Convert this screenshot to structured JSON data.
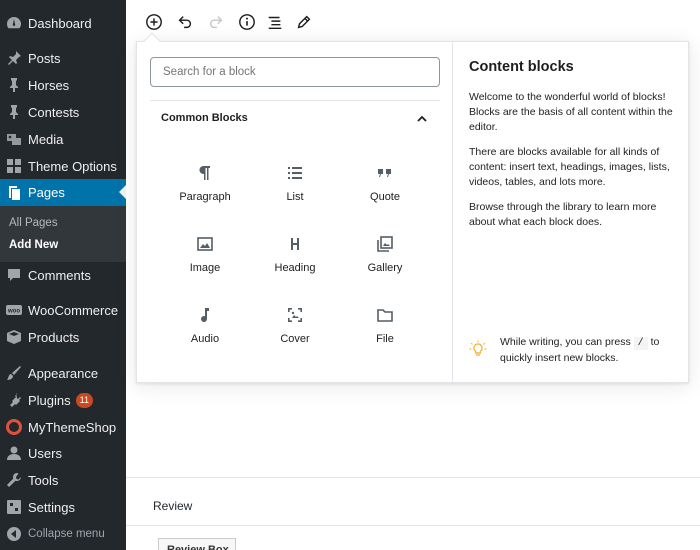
{
  "sidebar": {
    "items": [
      {
        "label": "Dashboard",
        "icon": "dashboard-icon"
      },
      {
        "label": "Posts",
        "icon": "pin-icon"
      },
      {
        "label": "Horses",
        "icon": "pin-icon"
      },
      {
        "label": "Contests",
        "icon": "pin-icon"
      },
      {
        "label": "Media",
        "icon": "media-icon"
      },
      {
        "label": "Theme Options",
        "icon": "grid-icon"
      },
      {
        "label": "Pages",
        "icon": "pages-icon",
        "active": true
      },
      {
        "label": "Comments",
        "icon": "comment-icon"
      },
      {
        "label": "WooCommerce",
        "icon": "woo-icon"
      },
      {
        "label": "Products",
        "icon": "box-icon"
      },
      {
        "label": "Appearance",
        "icon": "brush-icon"
      },
      {
        "label": "Plugins",
        "icon": "plug-icon",
        "badge": "11"
      },
      {
        "label": "MyThemeShop",
        "icon": "lifebuoy-icon"
      },
      {
        "label": "Users",
        "icon": "user-icon"
      },
      {
        "label": "Tools",
        "icon": "wrench-icon"
      },
      {
        "label": "Settings",
        "icon": "settings-icon"
      }
    ],
    "submenu": {
      "all_pages": "All Pages",
      "add_new": "Add New"
    },
    "collapse_label": "Collapse menu"
  },
  "toolbar": {
    "buttons": [
      "add-block-icon",
      "undo-icon",
      "redo-icon",
      "info-icon",
      "outline-icon",
      "edit-icon"
    ]
  },
  "inserter": {
    "search_placeholder": "Search for a block",
    "category_title": "Common Blocks",
    "blocks": [
      {
        "label": "Paragraph",
        "icon": "paragraph-icon"
      },
      {
        "label": "List",
        "icon": "list-icon"
      },
      {
        "label": "Quote",
        "icon": "quote-icon"
      },
      {
        "label": "Image",
        "icon": "image-icon"
      },
      {
        "label": "Heading",
        "icon": "heading-icon"
      },
      {
        "label": "Gallery",
        "icon": "gallery-icon"
      },
      {
        "label": "Audio",
        "icon": "audio-icon"
      },
      {
        "label": "Cover",
        "icon": "cover-icon"
      },
      {
        "label": "File",
        "icon": "file-icon"
      },
      {
        "label": "",
        "icon": "video-icon"
      }
    ],
    "help": {
      "title": "Content blocks",
      "p1": "Welcome to the wonderful world of blocks! Blocks are the basis of all content within the editor.",
      "p2": "There are blocks available for all kinds of content: insert text, headings, images, lists, videos, tables, and lots more.",
      "p3": "Browse through the library to learn more about what each block does.",
      "tip_before": "While writing, you can press",
      "tip_key": "/",
      "tip_after": "to quickly insert new blocks."
    }
  },
  "review": {
    "title": "Review",
    "box_button": "Review Box"
  },
  "colors": {
    "sidebar_bg": "#23282d",
    "active_bg": "#0073aa",
    "badge_bg": "#ca4a1f",
    "tip_icon": "#f0b849"
  }
}
